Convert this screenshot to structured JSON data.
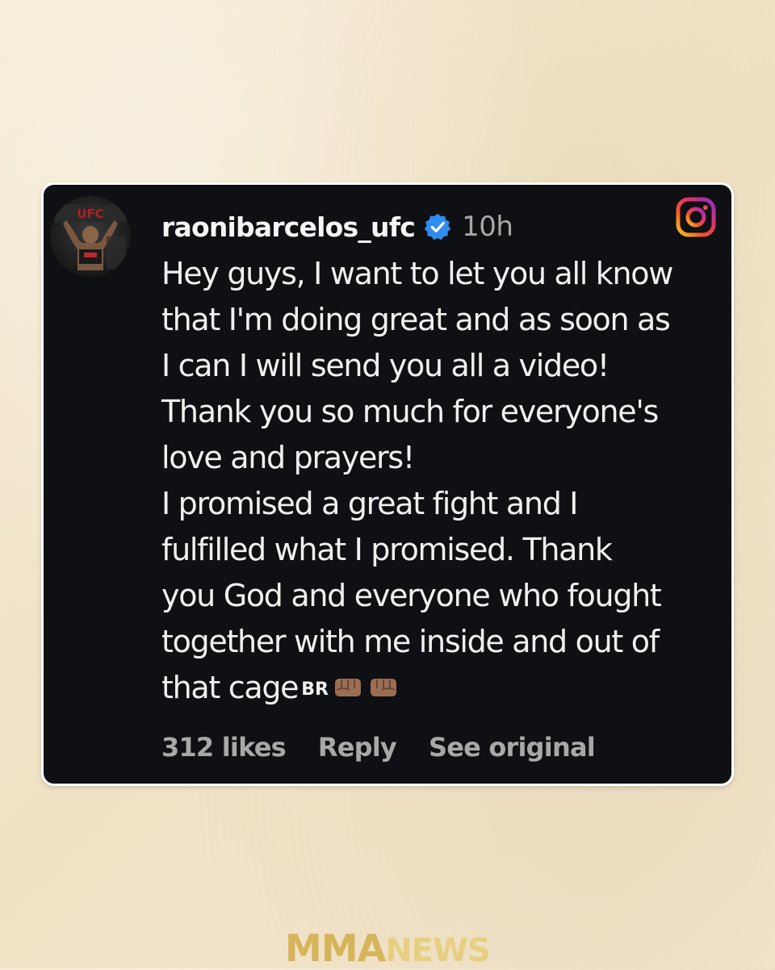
{
  "post": {
    "username": "raonibarcelos_ufc",
    "time": "10h",
    "comment_lines": [
      "Hey guys, I want to let you all know",
      "that I'm doing great and as soon as",
      "I can I will send you all a video!",
      "Thank you so much for everyone's",
      "love and prayers!",
      "I promised a great fight and I",
      "fulfilled what I promised. Thank",
      "you God and everyone who fought",
      "together with me inside and out of",
      "that cage"
    ],
    "flag_code": "BR",
    "likes": "312 likes",
    "reply_label": "Reply",
    "see_original_label": "See original"
  },
  "icons": {
    "platform": "instagram-icon",
    "verified": "verified-badge-icon",
    "emoji": "fist-bump-icon"
  },
  "colors": {
    "card_bg": "#0e1013",
    "verified_blue": "#2f8cf0",
    "page_bg": "#f3e6cc",
    "brand_gold": "#d6b45a"
  },
  "branding": {
    "logo_part1": "MMA",
    "logo_part2": "NEWS"
  }
}
